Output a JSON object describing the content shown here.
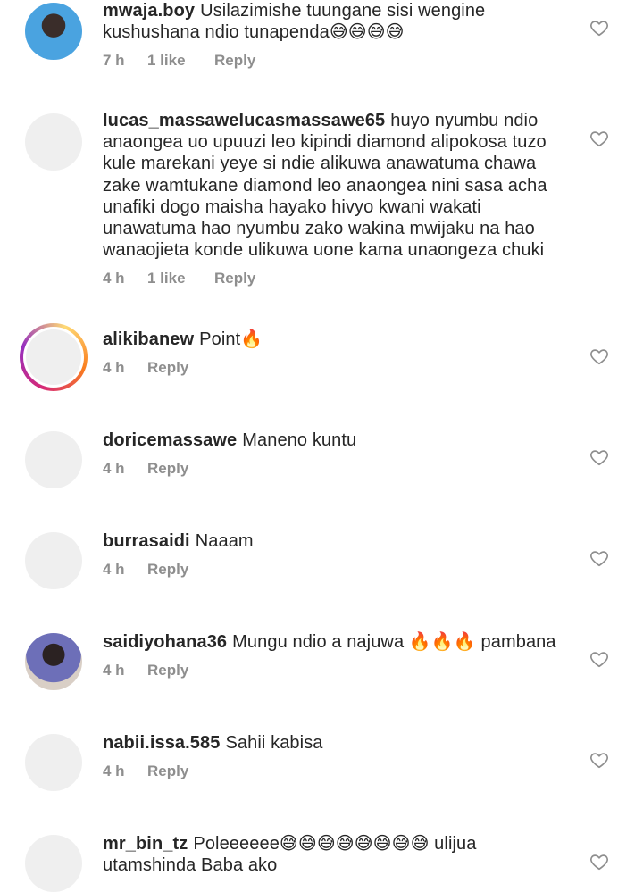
{
  "comments": [
    {
      "username": "mwaja.boy",
      "text": "Usilazimishe tuungane sisi wengine kushushana ndio tunapenda😅😅😅😅",
      "time": "7 h",
      "likes": "1 like",
      "reply": "Reply",
      "avatar": "photo"
    },
    {
      "username": "lucas_massawelucasmassawe65",
      "text": "huyo nyumbu ndio anaongea uo upuuzi leo kipindi diamond alipokosa tuzo kule marekani yeye si ndie alikuwa anawatuma chawa zake wamtukane diamond leo anaongea nini sasa acha unafiki dogo maisha hayako hivyo kwani wakati unawatuma hao nyumbu zako wakina mwijaku na hao wanaojieta konde ulikuwa uone kama unaongeza chuki",
      "time": "4 h",
      "likes": "1 like",
      "reply": "Reply",
      "avatar": "default"
    },
    {
      "username": "alikibanew",
      "text": "Point🔥",
      "time": "4 h",
      "likes": "",
      "reply": "Reply",
      "avatar": "story"
    },
    {
      "username": "doricemassawe",
      "text": "Maneno kuntu",
      "time": "4 h",
      "likes": "",
      "reply": "Reply",
      "avatar": "default"
    },
    {
      "username": "burrasaidi",
      "text": "Naaam",
      "time": "4 h",
      "likes": "",
      "reply": "Reply",
      "avatar": "default"
    },
    {
      "username": "saidiyohana36",
      "text": "Mungu ndio  a najuwa 🔥🔥🔥 pambana",
      "time": "4 h",
      "likes": "",
      "reply": "Reply",
      "avatar": "photo"
    },
    {
      "username": "nabii.issa.585",
      "text": "Sahii kabisa",
      "time": "4 h",
      "likes": "",
      "reply": "Reply",
      "avatar": "default"
    },
    {
      "username": "mr_bin_tz",
      "text": "Poleeeeee😅😅😅😅😅😅😅😅 ulijua utamshinda Baba ako",
      "time": "",
      "likes": "",
      "reply": "",
      "avatar": "default"
    }
  ],
  "icons": {
    "like": "heart-outline-icon"
  },
  "colors": {
    "meta": "#8e8e8e",
    "text": "#262626",
    "placeholder_avatar": "#efefef"
  }
}
